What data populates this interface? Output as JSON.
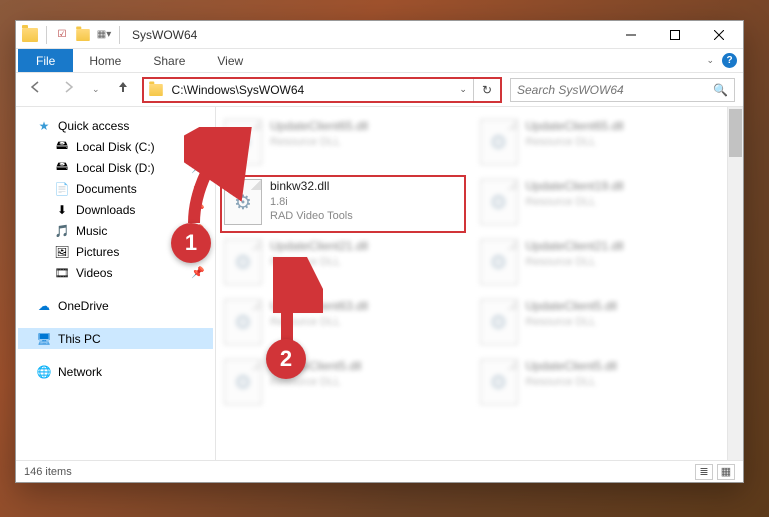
{
  "window": {
    "title": "SysWOW64"
  },
  "tabs": {
    "file": "File",
    "home": "Home",
    "share": "Share",
    "view": "View"
  },
  "nav": {
    "address": "C:\\Windows\\SysWOW64",
    "search_placeholder": "Search SysWOW64"
  },
  "sidebar": {
    "quick_access": "Quick access",
    "items": [
      {
        "label": "Local Disk (C:)"
      },
      {
        "label": "Local Disk (D:)"
      },
      {
        "label": "Documents"
      },
      {
        "label": "Downloads"
      },
      {
        "label": "Music"
      },
      {
        "label": "Pictures"
      },
      {
        "label": "Videos"
      }
    ],
    "onedrive": "OneDrive",
    "thispc": "This PC",
    "network": "Network"
  },
  "files": {
    "blurred": [
      {
        "name": "UpdateClient65.dll",
        "sub": "Resource DLL"
      },
      {
        "name": "UpdateClient65.dll",
        "sub": "Resource DLL"
      },
      {
        "name": "",
        "sub": ""
      },
      {
        "name": "UpdateClient19.dll",
        "sub": "Resource DLL"
      },
      {
        "name": "UpdateClient21.dll",
        "sub": "Resource DLL"
      },
      {
        "name": "UpdateClient21.dll",
        "sub": "Resource DLL"
      },
      {
        "name": "UpdateClient63.dll",
        "sub": "Resource DLL"
      },
      {
        "name": "UpdateClient5.dll",
        "sub": "Resource DLL"
      },
      {
        "name": "UpdateClient5.dll",
        "sub": "Resource DLL"
      },
      {
        "name": "UpdateClient5.dll",
        "sub": "Resource DLL"
      }
    ],
    "highlighted": {
      "name": "binkw32.dll",
      "line2": "1.8i",
      "line3": "RAD Video Tools"
    }
  },
  "status": {
    "left": "146 items"
  },
  "callouts": {
    "one": "1",
    "two": "2"
  }
}
